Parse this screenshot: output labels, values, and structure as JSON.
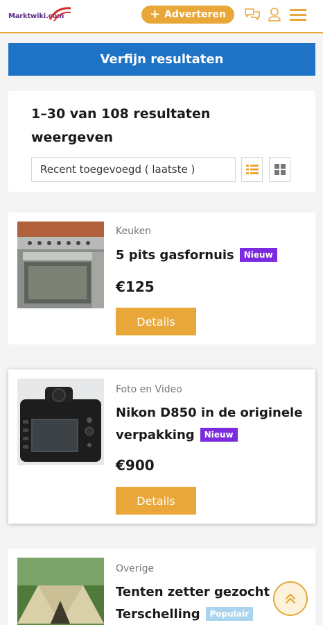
{
  "header": {
    "logo_text": "Marktwiki.com",
    "advertise_label": "Adverteren",
    "icons": [
      "chat-icon",
      "user-icon",
      "menu-icon"
    ]
  },
  "refine_label": "Verfijn resultaten",
  "results": {
    "count_text": "1–30 van 108 resultaten weergeven",
    "sort_value": "Recent toegevoegd ( laatste )"
  },
  "listings": [
    {
      "category": "Keuken",
      "title": "5 pits gasfornuis",
      "badge": "Nieuw",
      "price": "€125",
      "details_label": "Details"
    },
    {
      "category": "Foto en Video",
      "title": "Nikon D850 in de originele verpakking",
      "badge": "Nieuw",
      "price": "€900",
      "details_label": "Details"
    },
    {
      "category": "Overige",
      "title": "Tenten zetter gezocht Terschelling",
      "badge": "Populair"
    }
  ],
  "colors": {
    "accent": "#e8a738",
    "primary": "#1f73c6",
    "badge_new": "#7b2ae0",
    "badge_popular": "#a9d3ee"
  }
}
